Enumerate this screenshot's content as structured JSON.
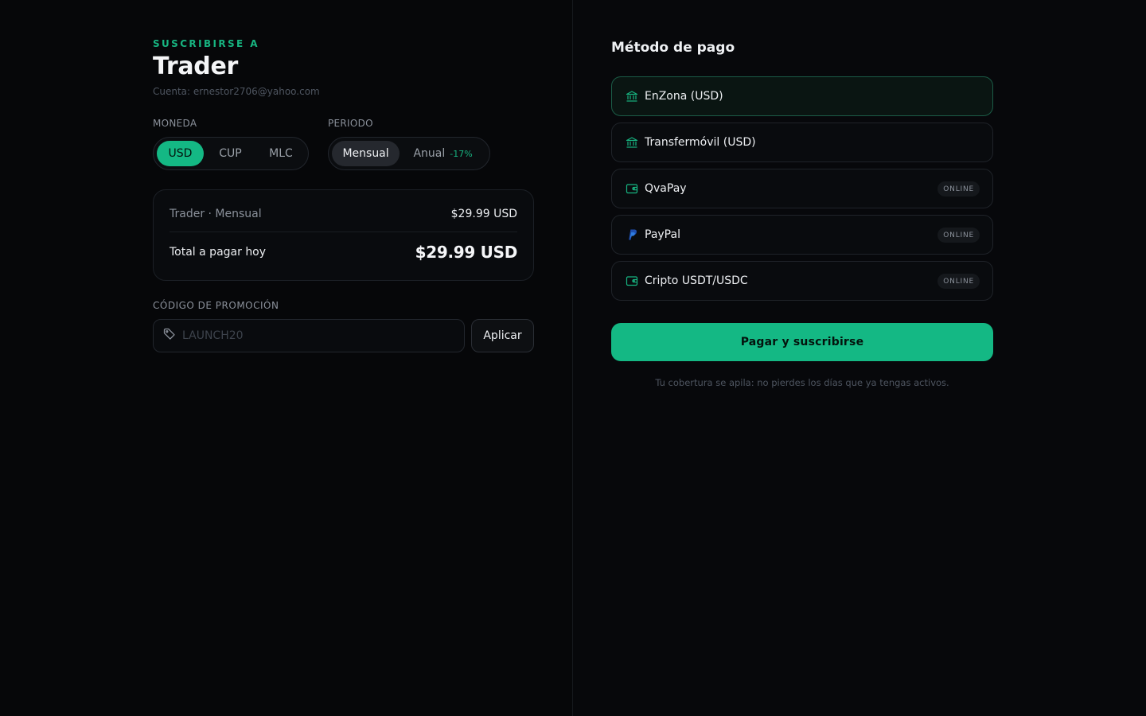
{
  "checkout": {
    "eyebrow": "SUSCRIBIRSE A",
    "plan_name": "Trader",
    "account_line": "Cuenta: ernestor2706@yahoo.com",
    "currency": {
      "label": "MONEDA",
      "options": [
        "USD",
        "CUP",
        "MLC"
      ],
      "selected": "USD"
    },
    "period": {
      "label": "PERIODO",
      "options": [
        {
          "label": "Mensual",
          "tag": ""
        },
        {
          "label": "Anual",
          "tag": "-17%"
        }
      ],
      "selected": "Mensual"
    },
    "summary": {
      "line_label": "Trader · Mensual",
      "line_value": "$29.99 USD",
      "total_label": "Total a pagar hoy",
      "total_value": "$29.99 USD"
    },
    "promo": {
      "label": "CÓDIGO DE PROMOCIÓN",
      "placeholder": "LAUNCH20",
      "value": "",
      "apply_label": "Aplicar"
    }
  },
  "payment": {
    "title": "Método de pago",
    "methods": [
      {
        "name": "EnZona (USD)",
        "icon": "bank-icon",
        "badge": "",
        "selected": true
      },
      {
        "name": "Transfermóvil (USD)",
        "icon": "bank-icon",
        "badge": "",
        "selected": false
      },
      {
        "name": "QvaPay",
        "icon": "wallet-icon",
        "badge": "ONLINE",
        "selected": false
      },
      {
        "name": "PayPal",
        "icon": "paypal-icon",
        "badge": "ONLINE",
        "selected": false
      },
      {
        "name": "Cripto USDT/USDC",
        "icon": "wallet-icon",
        "badge": "ONLINE",
        "selected": false
      }
    ],
    "submit_label": "Pagar y suscribirse",
    "note": "Tu cobertura se apila: no pierdes los días que ya tengas activos."
  },
  "colors": {
    "accent": "#14b884",
    "background": "#060709",
    "paypal": "#1e4fb0"
  }
}
